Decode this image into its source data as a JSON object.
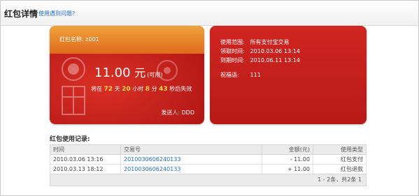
{
  "header": {
    "title": "红包详情",
    "help_link": "使用遇到问题?"
  },
  "card": {
    "name_label": "红包名称: ",
    "name_value": "z001",
    "amount": "11.00",
    "currency": "元",
    "availability": "(可用)",
    "countdown": {
      "prefix": "将在",
      "days": "72",
      "days_unit": "天",
      "hours": "20",
      "hours_unit": "小时",
      "minutes": "8",
      "minutes_unit": "分",
      "seconds": "43",
      "seconds_suffix": "秒后失效"
    },
    "sender_label": "发送人: ",
    "sender_value": "DDD"
  },
  "info": {
    "scope_label": "使用范围:",
    "scope_value": "所有支付宝交易",
    "claim_label": "领取时间:",
    "claim_value": "2010.03.06 13:14",
    "expire_label": "到期时间:",
    "expire_value": "2010.06.11 13:14",
    "wish_label": "祝福语:",
    "wish_value": "111"
  },
  "records": {
    "title": "红包使用记录:",
    "columns": [
      "时间",
      "交易号",
      "金额(元)",
      "使用类型"
    ],
    "rows": [
      {
        "time": "2010.03.06 13:16",
        "trade_no": "2010030606240133",
        "amount": "- 11.00",
        "type": "红包支付"
      },
      {
        "time": "2010.03.13 18:12",
        "trade_no": "2010030606240133",
        "amount": "+ 11.00",
        "type": "红包退款"
      }
    ],
    "pager": "1 - 2条，共2条 1"
  }
}
